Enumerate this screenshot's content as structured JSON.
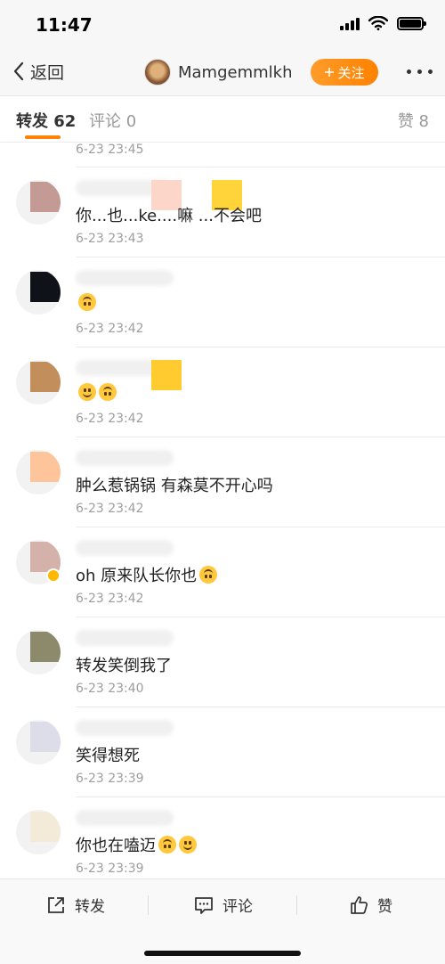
{
  "status_bar": {
    "time": "11:47"
  },
  "nav": {
    "back_label": "返回",
    "username": "Mamgemmlkh",
    "follow_label": "关注"
  },
  "tabs": {
    "repost": "转发 62",
    "comment": "评论 0",
    "like": "赞 8"
  },
  "list": {
    "first_time": "6-23 23:45",
    "items": [
      {
        "text": "你...也...ke....嘛 ...不会吧",
        "time": "6-23 23:43",
        "emojis": [],
        "avatar_color": "#c49a94",
        "blots": [
          "#fcd6c8",
          "#ffd43a"
        ]
      },
      {
        "text": "",
        "time": "6-23 23:42",
        "emojis": [
          "upside-down-face"
        ],
        "avatar_color": "#10121a",
        "blots": []
      },
      {
        "text": "",
        "time": "6-23 23:42",
        "emojis": [
          "slightly-smiling-face",
          "upside-down-face"
        ],
        "avatar_color": "#c28f5c",
        "blots": [
          "#ffcb2e"
        ]
      },
      {
        "text": "肿么惹锅锅 有森莫不开心吗",
        "time": "6-23 23:42",
        "emojis": [],
        "avatar_color": "#ffc59a",
        "blots": []
      },
      {
        "text": "oh 原来队长你也",
        "time": "6-23 23:42",
        "emojis": [
          "upside-down-face"
        ],
        "avatar_color": "#d4b2a9",
        "blots": [],
        "verified": true
      },
      {
        "text": "转发笑倒我了",
        "time": "6-23 23:40",
        "emojis": [],
        "avatar_color": "#8c8a6a",
        "blots": []
      },
      {
        "text": "笑得想死",
        "time": "6-23 23:39",
        "emojis": [],
        "avatar_color": "#dcdde8",
        "blots": []
      },
      {
        "text": "你也在嗑迈",
        "time": "6-23 23:39",
        "emojis": [
          "upside-down-face",
          "slightly-smiling-face"
        ],
        "avatar_color": "#f3ead8",
        "blots": []
      }
    ]
  },
  "actions": {
    "repost_label": "转发",
    "comment_label": "评论",
    "like_label": "赞"
  },
  "colors": {
    "accent": "#ff8200",
    "meta_text": "#9e9e9e"
  }
}
